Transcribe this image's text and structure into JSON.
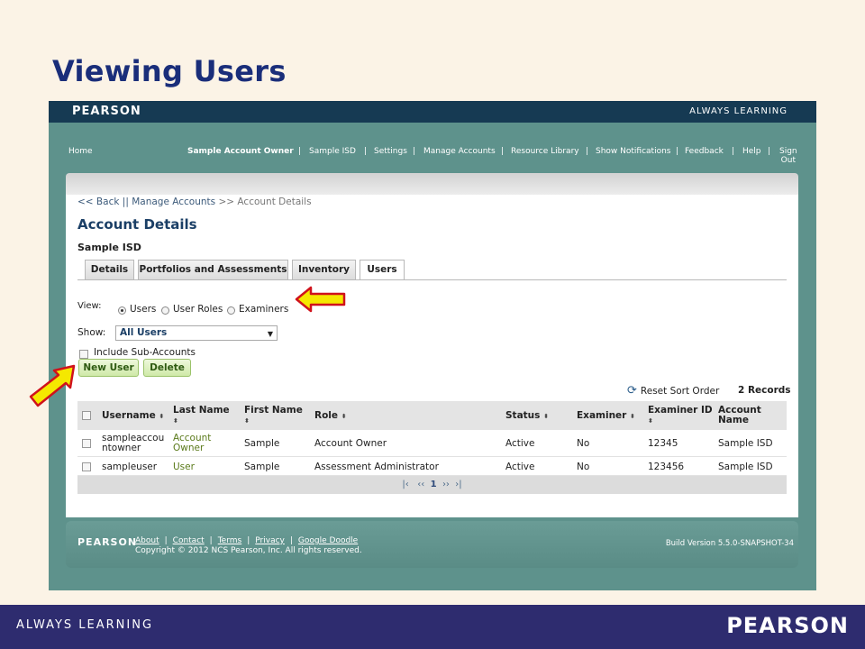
{
  "slide": {
    "title": "Viewing Users",
    "footer_tagline": "ALWAYS LEARNING",
    "footer_logo": "PEARSON"
  },
  "app": {
    "logo": "PEARSON",
    "tagline": "ALWAYS LEARNING",
    "nav": {
      "home": "Home",
      "user": "Sample Account Owner",
      "sep": "|",
      "items": [
        "Sample ISD",
        "Settings",
        "Manage Accounts",
        "Resource Library",
        "Show Notifications",
        "Feedback",
        "Help"
      ],
      "signout_1": "Sign",
      "signout_2": "Out"
    },
    "breadcrumb": {
      "back": "<< Back",
      "divider": "||",
      "manage": "Manage Accounts",
      "arrow": ">>",
      "current": "Account Details"
    },
    "section_title": "Account Details",
    "account_name": "Sample ISD",
    "tabs": [
      "Details",
      "Portfolios and Assessments",
      "Inventory",
      "Users"
    ],
    "active_tab": "Users",
    "view": {
      "label": "View:",
      "options": [
        "Users",
        "User Roles",
        "Examiners"
      ],
      "selected": "Users"
    },
    "show": {
      "label": "Show:",
      "value": "All Users"
    },
    "include_sub_accounts": "Include Sub-Accounts",
    "buttons": {
      "new_user": "New User",
      "delete": "Delete"
    },
    "reset_sort": "Reset Sort Order",
    "records": "2 Records",
    "table": {
      "headers": {
        "username": "Username",
        "last_name": "Last Name",
        "first_name": "First Name",
        "role": "Role",
        "status": "Status",
        "examiner": "Examiner",
        "examiner_id": "Examiner ID",
        "account_name_1": "Account",
        "account_name_2": "Name",
        "sort": "⬍"
      },
      "rows": [
        {
          "username_1": "sampleaccou",
          "username_2": "ntowner",
          "last_name_1": "Account",
          "last_name_2": "Owner",
          "first_name": "Sample",
          "role": "Account Owner",
          "status": "Active",
          "examiner": "No",
          "examiner_id": "12345",
          "account_name": "Sample ISD"
        },
        {
          "username_1": "sampleuser",
          "username_2": "",
          "last_name_1": "User",
          "last_name_2": "",
          "first_name": "Sample",
          "role": "Assessment Administrator",
          "status": "Active",
          "examiner": "No",
          "examiner_id": "123456",
          "account_name": "Sample ISD"
        }
      ],
      "pager": {
        "first": "|‹",
        "prev": "‹‹",
        "page": "1",
        "next": "››",
        "last": "›|"
      }
    },
    "footer": {
      "logo": "PEARSON",
      "links": [
        "About",
        "Contact",
        "Terms",
        "Privacy",
        "Google Doodle"
      ],
      "link_sep": "|",
      "copyright": "Copyright © 2012 NCS Pearson, Inc. All rights reserved.",
      "build": "Build Version 5.5.0-SNAPSHOT-34"
    }
  },
  "colors": {
    "arrow_fill": "#f5e800",
    "arrow_stroke": "#d0121b"
  }
}
